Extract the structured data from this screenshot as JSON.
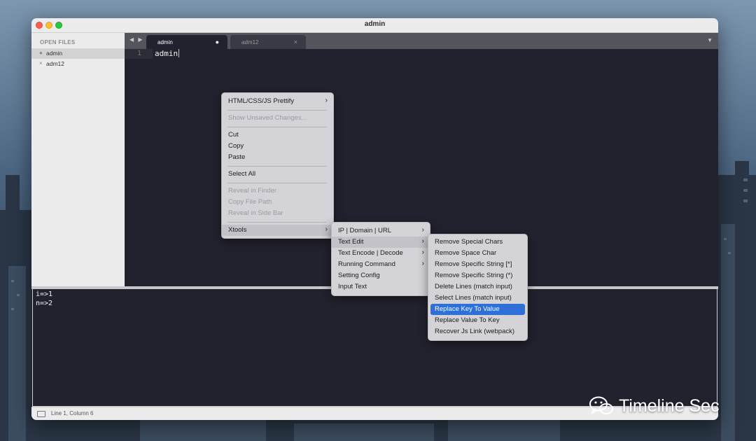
{
  "window": {
    "title": "admin"
  },
  "sidebar": {
    "header": "OPEN FILES",
    "items": [
      {
        "label": "admin",
        "marker": "●"
      },
      {
        "label": "adm12",
        "marker": "×"
      }
    ]
  },
  "tabs": {
    "nav": "◀ ▶",
    "items": [
      {
        "label": "admin",
        "marker": "●"
      },
      {
        "label": "adm12",
        "marker": "×"
      }
    ],
    "menu_glyph": "▼"
  },
  "editor": {
    "line_number": "1",
    "code": "admin"
  },
  "console": {
    "lines": [
      "i=>1",
      "n=>2"
    ]
  },
  "status": {
    "text": "Line 1, Column 6"
  },
  "context_menu": {
    "items": [
      {
        "label": "HTML/CSS/JS Prettify",
        "arrow": "›"
      },
      {
        "label": "Show Unsaved Changes..."
      },
      {
        "label": "Cut"
      },
      {
        "label": "Copy"
      },
      {
        "label": "Paste"
      },
      {
        "label": "Select All"
      },
      {
        "label": "Reveal in Finder"
      },
      {
        "label": "Copy File Path"
      },
      {
        "label": "Reveal in Side Bar"
      },
      {
        "label": "Xtools",
        "arrow": "›"
      }
    ]
  },
  "xtools_menu": {
    "items": [
      {
        "label": "IP | Domain | URL",
        "arrow": "›"
      },
      {
        "label": "Text Edit",
        "arrow": "›"
      },
      {
        "label": "Text Encode | Decode",
        "arrow": "›"
      },
      {
        "label": "Running Command",
        "arrow": "›"
      },
      {
        "label": "Setting Config"
      },
      {
        "label": "Input Text"
      }
    ]
  },
  "text_edit_menu": {
    "items": [
      {
        "label": "Remove Special Chars"
      },
      {
        "label": "Remove Space Char"
      },
      {
        "label": "Remove Specific String [*]"
      },
      {
        "label": "Remove Specific String (*)"
      },
      {
        "label": "Delete Lines (match input)"
      },
      {
        "label": "Select Lines (match input)"
      },
      {
        "label": "Replace Key To Value"
      },
      {
        "label": "Replace Value To Key"
      },
      {
        "label": "Recover Js Link (webpack)"
      }
    ]
  },
  "watermark": {
    "text": "Timeline Sec"
  }
}
